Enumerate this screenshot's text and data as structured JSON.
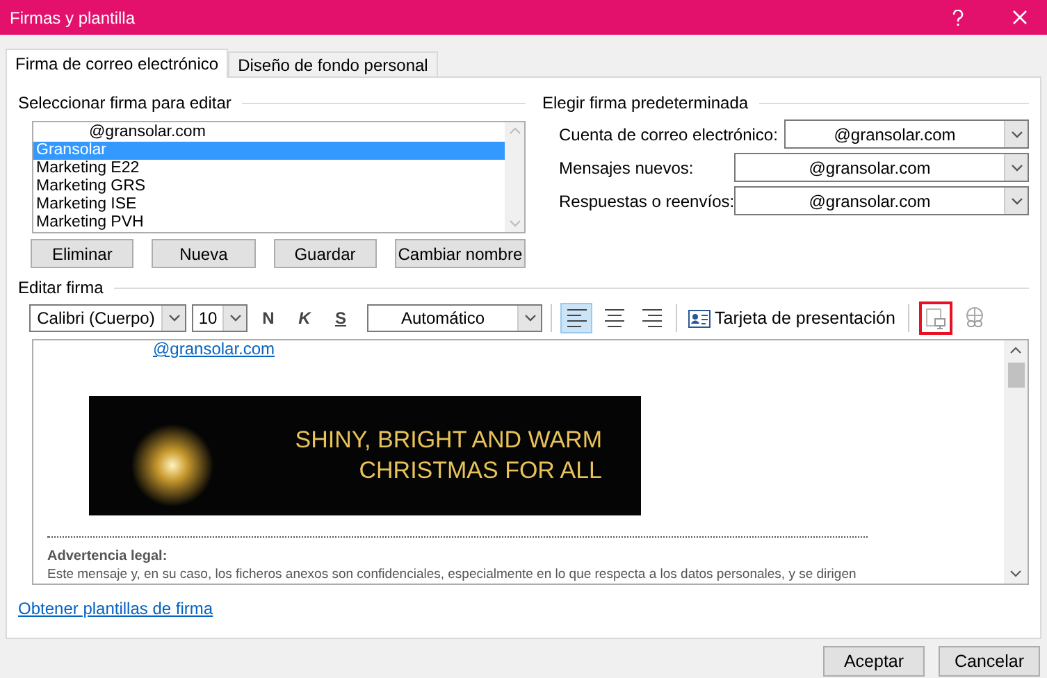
{
  "window": {
    "title": "Firmas y plantilla"
  },
  "tabs": [
    {
      "label": "Firma de correo electrónico",
      "selected": true
    },
    {
      "label": "Diseño de fondo personal",
      "selected": false
    }
  ],
  "select_signature": {
    "label": "Seleccionar firma para editar",
    "items": [
      {
        "label": "@gransolar.com",
        "selected": false
      },
      {
        "label": "Gransolar",
        "selected": true
      },
      {
        "label": "Marketing E22",
        "selected": false
      },
      {
        "label": "Marketing GRS",
        "selected": false
      },
      {
        "label": "Marketing ISE",
        "selected": false
      },
      {
        "label": "Marketing PVH",
        "selected": false
      }
    ],
    "buttons": [
      "Eliminar",
      "Nueva",
      "Guardar",
      "Cambiar nombre"
    ]
  },
  "default_signature": {
    "label": "Elegir firma predeterminada",
    "fields": [
      {
        "label": "Cuenta de correo electrónico:",
        "value": "@gransolar.com"
      },
      {
        "label": "Mensajes nuevos:",
        "value": "@gransolar.com"
      },
      {
        "label": "Respuestas o reenvíos:",
        "value": "@gransolar.com"
      }
    ]
  },
  "edit_signature": {
    "label": "Editar firma",
    "toolbar": {
      "font": "Calibri (Cuerpo)",
      "size": "10",
      "bold": "N",
      "italic": "K",
      "underline": "S",
      "color_picker": "Automático",
      "alignment": [
        {
          "kind": "left",
          "selected": true
        },
        {
          "kind": "center",
          "selected": false
        },
        {
          "kind": "right",
          "selected": false
        }
      ],
      "business_card": "Tarjeta de presentación",
      "tools": [
        {
          "kind": "picture",
          "highlighted": true
        },
        {
          "kind": "link",
          "highlighted": false
        }
      ]
    },
    "content": {
      "email": "@gransolar.com",
      "banner": [
        "SHINY, BRIGHT AND WARM",
        "CHRISTMAS FOR ALL"
      ],
      "legal_title": "Advertencia legal:",
      "legal_text": "Este mensaje y, en su caso, los ficheros anexos son confidenciales, especialmente en lo que respecta a los datos personales, y se dirigen"
    }
  },
  "templates_link": "Obtener plantillas de firma",
  "buttons": [
    "Aceptar",
    "Cancelar"
  ]
}
